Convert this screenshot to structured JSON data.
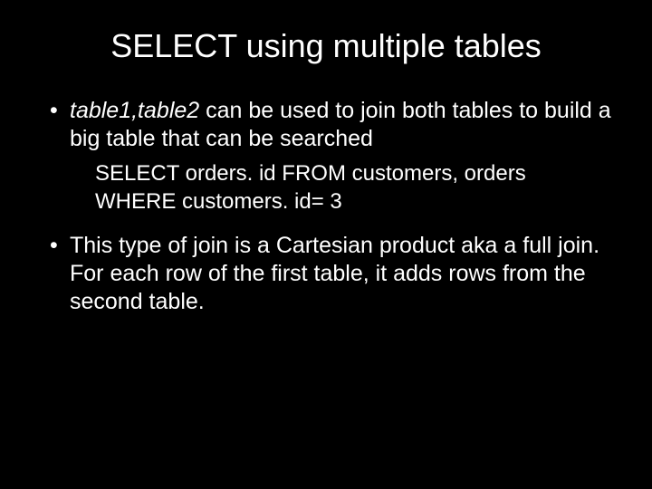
{
  "title": "SELECT using multiple tables",
  "bullets": {
    "b1_italic": "table1,table2",
    "b1_rest": "  can be used to join both tables to build a big table that can be searched",
    "code_l1": "SELECT orders. id FROM customers, orders",
    "code_l2": "WHERE customers. id= 3",
    "b2": "This type of join is a Cartesian product aka a full join. For each row of the first table, it adds rows from the second table."
  }
}
